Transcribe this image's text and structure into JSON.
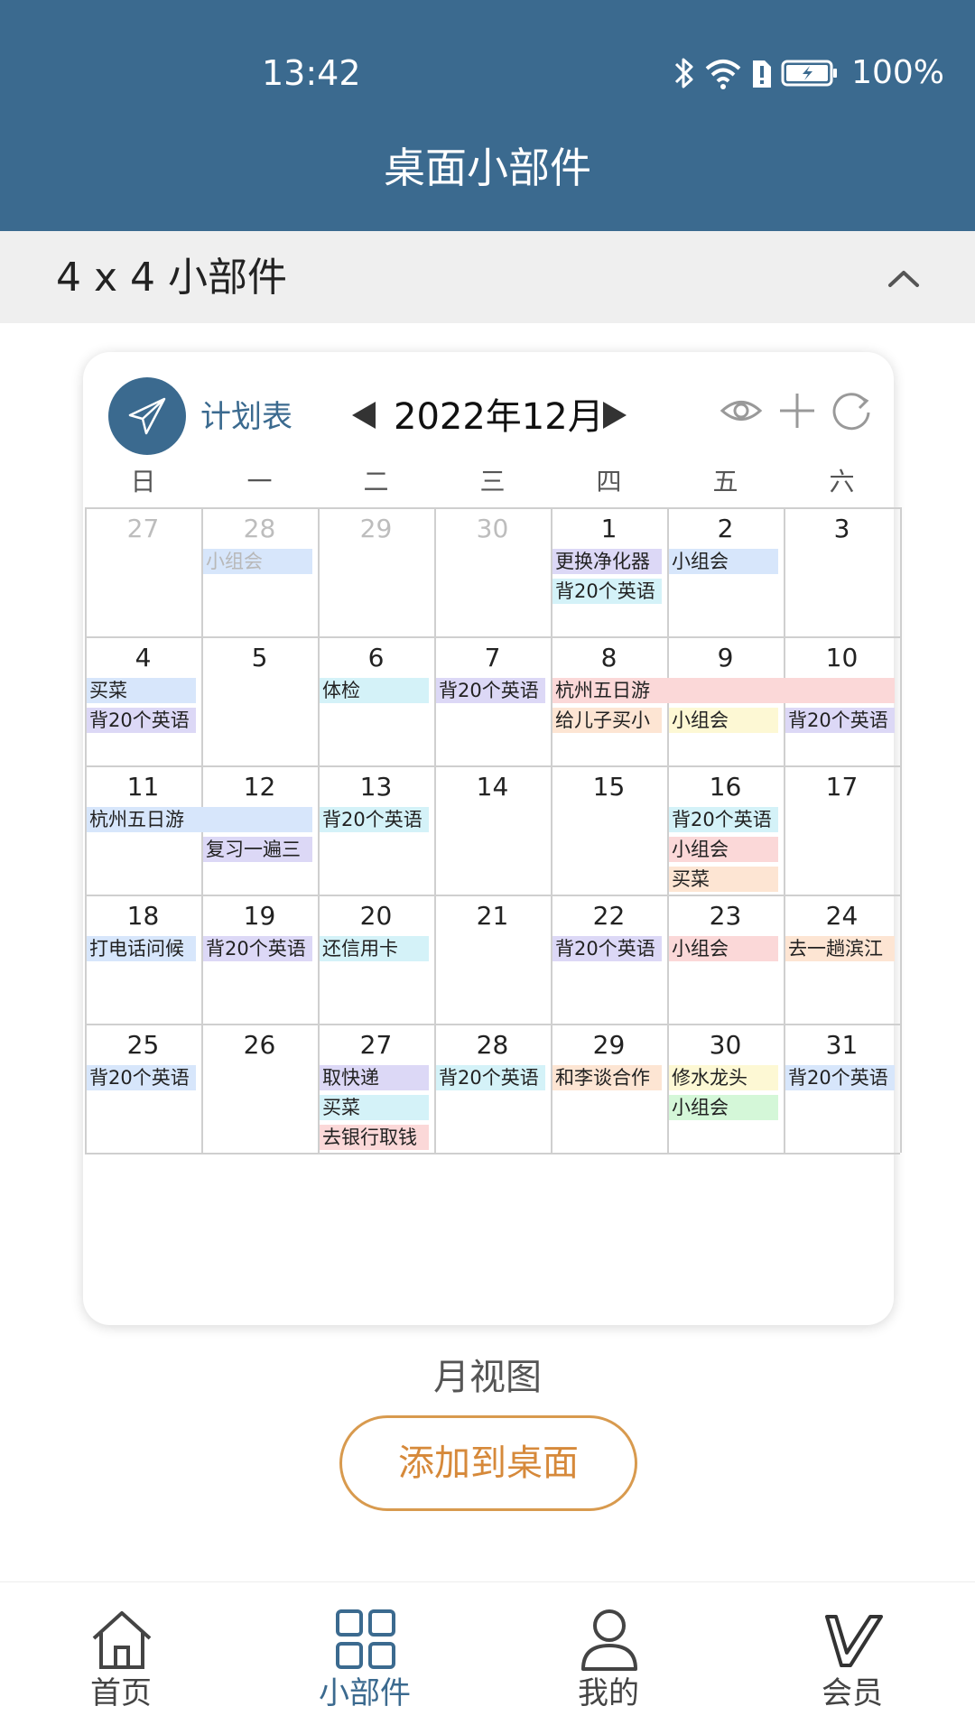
{
  "status_bar": {
    "time": "13:42",
    "battery": "100%"
  },
  "header": {
    "title": "桌面小部件"
  },
  "section": {
    "title": "4 x 4 小部件"
  },
  "widget": {
    "app_name": "计划表",
    "month": "2022年12月",
    "weekdays": [
      "日",
      "一",
      "二",
      "三",
      "四",
      "五",
      "六"
    ],
    "weeks": [
      {
        "days": [
          {
            "num": "27",
            "dim": true
          },
          {
            "num": "28",
            "dim": true
          },
          {
            "num": "29",
            "dim": true
          },
          {
            "num": "30",
            "dim": true
          },
          {
            "num": "1"
          },
          {
            "num": "2"
          },
          {
            "num": "3"
          }
        ],
        "events": [
          {
            "text": "小组会",
            "col": 1,
            "span": 1,
            "slot": 0,
            "color": "#d7e6fb",
            "dim": true
          },
          {
            "text": "更换净化器",
            "col": 4,
            "span": 1,
            "slot": 0,
            "color": "#dcd8f6"
          },
          {
            "text": "背20个英语",
            "col": 4,
            "span": 1,
            "slot": 1,
            "color": "#d4f2f8"
          },
          {
            "text": "小组会",
            "col": 5,
            "span": 1,
            "slot": 0,
            "color": "#d7e6fb"
          }
        ]
      },
      {
        "days": [
          {
            "num": "4"
          },
          {
            "num": "5"
          },
          {
            "num": "6"
          },
          {
            "num": "7"
          },
          {
            "num": "8"
          },
          {
            "num": "9"
          },
          {
            "num": "10"
          }
        ],
        "events": [
          {
            "text": "买菜",
            "col": 0,
            "span": 1,
            "slot": 0,
            "color": "#d7e6fb"
          },
          {
            "text": "背20个英语",
            "col": 0,
            "span": 1,
            "slot": 1,
            "color": "#dcd8f6"
          },
          {
            "text": "体检",
            "col": 2,
            "span": 1,
            "slot": 0,
            "color": "#d4f2f8"
          },
          {
            "text": "背20个英语",
            "col": 3,
            "span": 1,
            "slot": 0,
            "color": "#dcd8f6"
          },
          {
            "text": "杭州五日游",
            "col": 4,
            "span": 3,
            "slot": 0,
            "color": "#fbd8d8"
          },
          {
            "text": "给儿子买小",
            "col": 4,
            "span": 1,
            "slot": 1,
            "color": "#fde5d3"
          },
          {
            "text": "小组会",
            "col": 5,
            "span": 1,
            "slot": 1,
            "color": "#fdf8d4"
          },
          {
            "text": "背20个英语",
            "col": 6,
            "span": 1,
            "slot": 1,
            "color": "#dcd8f6"
          }
        ]
      },
      {
        "days": [
          {
            "num": "11"
          },
          {
            "num": "12"
          },
          {
            "num": "13"
          },
          {
            "num": "14"
          },
          {
            "num": "15"
          },
          {
            "num": "16"
          },
          {
            "num": "17"
          }
        ],
        "events": [
          {
            "text": "杭州五日游",
            "col": 0,
            "span": 2,
            "slot": 0,
            "color": "#d7e6fb"
          },
          {
            "text": "复习一遍三",
            "col": 1,
            "span": 1,
            "slot": 1,
            "color": "#dcd8f6"
          },
          {
            "text": "背20个英语",
            "col": 2,
            "span": 1,
            "slot": 0,
            "color": "#d4f2f8"
          },
          {
            "text": "背20个英语",
            "col": 5,
            "span": 1,
            "slot": 0,
            "color": "#d4f2f8"
          },
          {
            "text": "小组会",
            "col": 5,
            "span": 1,
            "slot": 1,
            "color": "#fbd8d8"
          },
          {
            "text": "买菜",
            "col": 5,
            "span": 1,
            "slot": 2,
            "color": "#fde5d3"
          }
        ]
      },
      {
        "days": [
          {
            "num": "18"
          },
          {
            "num": "19"
          },
          {
            "num": "20"
          },
          {
            "num": "21"
          },
          {
            "num": "22"
          },
          {
            "num": "23"
          },
          {
            "num": "24"
          }
        ],
        "events": [
          {
            "text": "打电话问候",
            "col": 0,
            "span": 1,
            "slot": 0,
            "color": "#d7e6fb"
          },
          {
            "text": "背20个英语",
            "col": 1,
            "span": 1,
            "slot": 0,
            "color": "#dcd8f6"
          },
          {
            "text": "还信用卡",
            "col": 2,
            "span": 1,
            "slot": 0,
            "color": "#d4f2f8"
          },
          {
            "text": "背20个英语",
            "col": 4,
            "span": 1,
            "slot": 0,
            "color": "#dcd8f6"
          },
          {
            "text": "小组会",
            "col": 5,
            "span": 1,
            "slot": 0,
            "color": "#fbd8d8"
          },
          {
            "text": "去一趟滨江",
            "col": 6,
            "span": 1,
            "slot": 0,
            "color": "#fde5d3"
          }
        ]
      },
      {
        "days": [
          {
            "num": "25"
          },
          {
            "num": "26"
          },
          {
            "num": "27"
          },
          {
            "num": "28"
          },
          {
            "num": "29"
          },
          {
            "num": "30"
          },
          {
            "num": "31"
          }
        ],
        "events": [
          {
            "text": "背20个英语",
            "col": 0,
            "span": 1,
            "slot": 0,
            "color": "#d7e6fb"
          },
          {
            "text": "取快递",
            "col": 2,
            "span": 1,
            "slot": 0,
            "color": "#dcd8f6"
          },
          {
            "text": "买菜",
            "col": 2,
            "span": 1,
            "slot": 1,
            "color": "#d4f2f8"
          },
          {
            "text": "去银行取钱",
            "col": 2,
            "span": 1,
            "slot": 2,
            "color": "#fbd8d8"
          },
          {
            "text": "背20个英语",
            "col": 3,
            "span": 1,
            "slot": 0,
            "color": "#d4f2f8"
          },
          {
            "text": "和李谈合作",
            "col": 4,
            "span": 1,
            "slot": 0,
            "color": "#fde5d3"
          },
          {
            "text": "修水龙头",
            "col": 5,
            "span": 1,
            "slot": 0,
            "color": "#fdf8d4"
          },
          {
            "text": "小组会",
            "col": 5,
            "span": 1,
            "slot": 1,
            "color": "#d4f7d8"
          },
          {
            "text": "背20个英语",
            "col": 6,
            "span": 1,
            "slot": 0,
            "color": "#d7e6fb"
          }
        ]
      }
    ]
  },
  "caption": "月视图",
  "add_button": "添加到桌面",
  "nav": {
    "items": [
      {
        "label": "首页",
        "icon": "home-icon"
      },
      {
        "label": "小部件",
        "icon": "widgets-icon",
        "active": true
      },
      {
        "label": "我的",
        "icon": "user-icon"
      },
      {
        "label": "会员",
        "icon": "vip-icon"
      }
    ]
  },
  "colors": {
    "primary": "#3b6a8f",
    "accent": "#d6893a"
  }
}
